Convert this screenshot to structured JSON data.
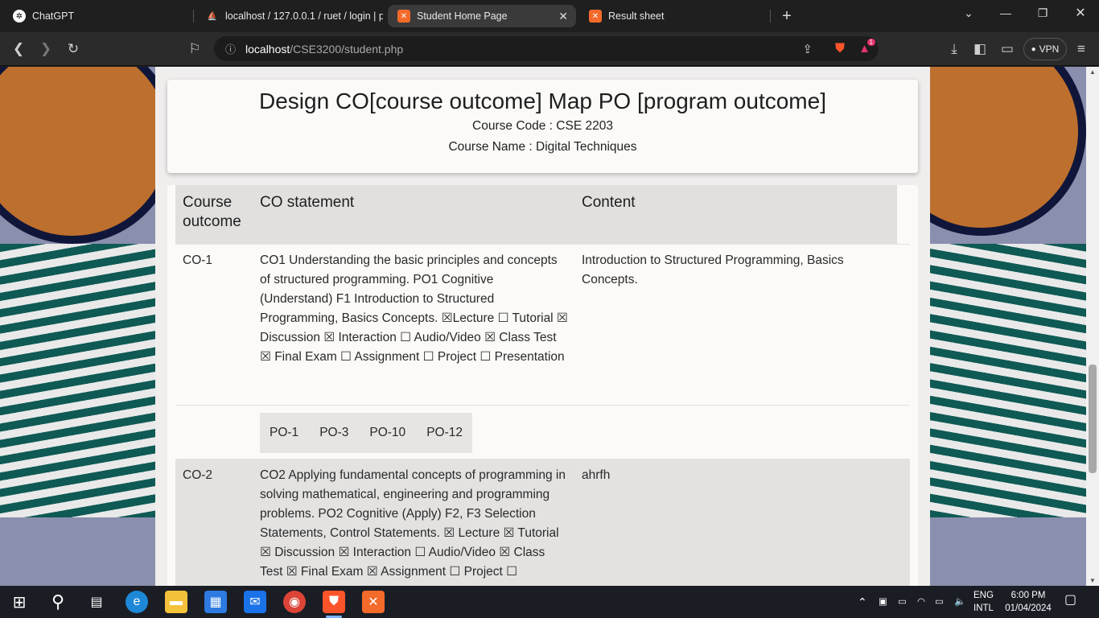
{
  "browser": {
    "tabs": [
      {
        "label": "ChatGPT",
        "icon": "chatgpt-icon",
        "active": false
      },
      {
        "label": "localhost / 127.0.0.1 / ruet / login | p",
        "icon": "phpmyadmin-icon",
        "active": false
      },
      {
        "label": "Student Home Page",
        "icon": "xampp-icon",
        "active": true
      },
      {
        "label": "Result sheet",
        "icon": "xampp-icon",
        "active": false
      }
    ],
    "url_host": "localhost",
    "url_path": "/CSE3200/student.php",
    "vpn_label": "VPN",
    "brave_badge": "1"
  },
  "header": {
    "title": "Design CO[course outcome] Map PO [program outcome]",
    "course_code": "Course Code : CSE 2203",
    "course_name": "Course Name : Digital Techniques"
  },
  "table": {
    "headers": [
      "Course outcome",
      "CO statement",
      "Content"
    ],
    "rows": [
      {
        "co": "CO-1",
        "statement": "CO1 Understanding the basic principles and concepts of structured programming. PO1 Cognitive (Understand) F1 Introduction to Structured Programming, Basics Concepts. ☒Lecture ☐ Tutorial ☒ Discussion ☒ Interaction ☐ Audio/Video ☒ Class Test ☒ Final Exam ☐ Assignment ☐ Project ☐ Presentation",
        "content": "Introduction to Structured Programming, Basics Concepts.",
        "pos": [
          "PO-1",
          "PO-3",
          "PO-10",
          "PO-12"
        ]
      },
      {
        "co": "CO-2",
        "statement": "CO2 Applying fundamental concepts of programming in solving mathematical, engineering and programming problems. PO2 Cognitive (Apply) F2, F3 Selection Statements, Control Statements. ☒ Lecture ☒ Tutorial ☒ Discussion ☒ Interaction ☐ Audio/Video ☒ Class Test ☒ Final Exam ☒ Assignment ☐ Project ☐",
        "content": "ahrfh"
      }
    ]
  },
  "taskbar": {
    "lang_top": "ENG",
    "lang_bottom": "INTL",
    "time": "6:00 PM",
    "date": "01/04/2024"
  },
  "colors": {
    "accent_active_tab": "#3a3a3a",
    "page_bg": "#8a8fae",
    "panel_bg": "#efeeed"
  }
}
